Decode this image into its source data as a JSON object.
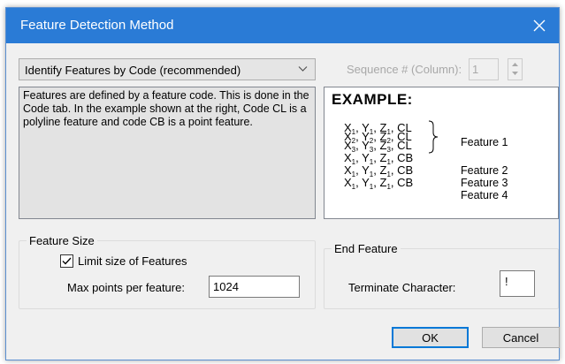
{
  "window": {
    "title": "Feature Detection Method",
    "close_icon": "close-icon",
    "accent": "#2a7bd6"
  },
  "method": {
    "selected": "Identify Features by Code (recommended)",
    "chevron_icon": "chevron-down-icon"
  },
  "sequence": {
    "label": "Sequence # (Column):",
    "value": "1",
    "disabled": true,
    "spin_icons": [
      "chevron-up-icon",
      "chevron-down-icon"
    ]
  },
  "description": "Features are defined by a feature code. This is done in the Code tab.  In the example shown at the right, Code CL is a polyline feature and code CB is a point feature.",
  "example": {
    "title": "EXAMPLE:",
    "rows": [
      {
        "x": "X",
        "xs": "1",
        "y": "Y",
        "ys": "1",
        "z": "Z",
        "zs": "1",
        "code": "CL"
      },
      {
        "x": "X",
        "xs": "2",
        "y": "Y",
        "ys": "2",
        "z": "Z",
        "zs": "2",
        "code": "CL"
      },
      {
        "x": "X",
        "xs": "3",
        "y": "Y",
        "ys": "3",
        "z": "Z",
        "zs": "3",
        "code": "CL"
      },
      {
        "x": "X",
        "xs": "1",
        "y": "Y",
        "ys": "1",
        "z": "Z",
        "zs": "1",
        "code": "CB"
      },
      {
        "x": "X",
        "xs": "1",
        "y": "Y",
        "ys": "1",
        "z": "Z",
        "zs": "1",
        "code": "CB"
      },
      {
        "x": "X",
        "xs": "1",
        "y": "Y",
        "ys": "1",
        "z": "Z",
        "zs": "1",
        "code": "CB"
      }
    ],
    "features": [
      "Feature 1",
      "Feature 2",
      "Feature 3",
      "Feature 4"
    ]
  },
  "feature_size": {
    "legend": "Feature Size",
    "limit_label": "Limit size of Features",
    "limit_checked": true,
    "max_points_label": "Max points per feature:",
    "max_points_value": "1024"
  },
  "end_feature": {
    "legend": "End Feature",
    "terminate_label": "Terminate Character:",
    "terminate_value": "!"
  },
  "buttons": {
    "ok": "OK",
    "cancel": "Cancel"
  }
}
